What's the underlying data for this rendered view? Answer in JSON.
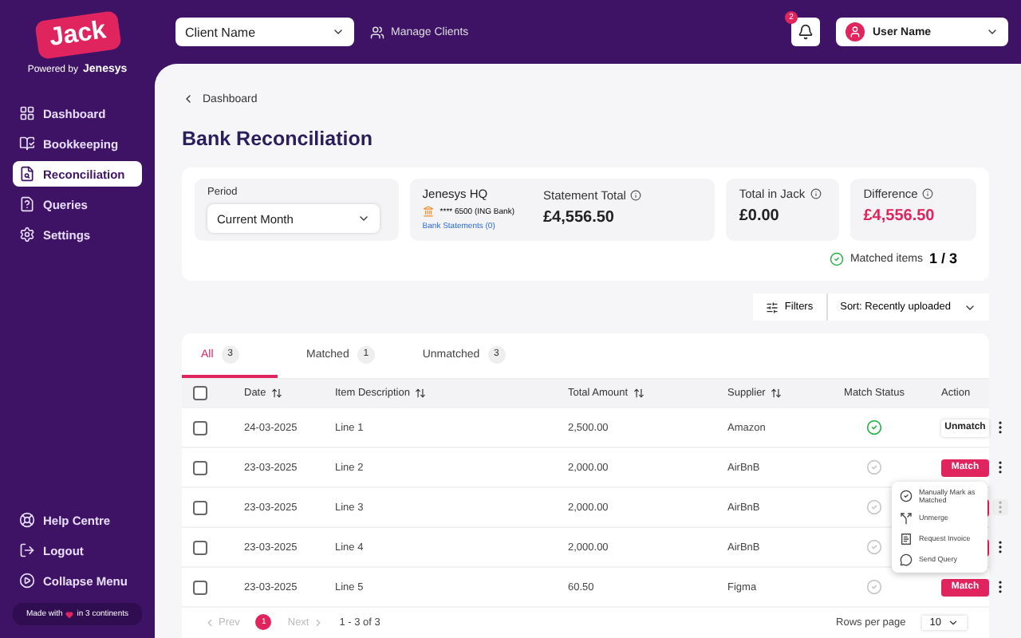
{
  "sidebar": {
    "logo": "Jack",
    "powered_by": "Powered by",
    "brand": "Jenesys",
    "items": [
      {
        "label": "Dashboard",
        "selected": false
      },
      {
        "label": "Bookkeeping",
        "selected": false
      },
      {
        "label": "Reconciliation",
        "selected": true
      },
      {
        "label": "Queries",
        "selected": false
      },
      {
        "label": "Settings",
        "selected": false
      }
    ],
    "bottom_items": [
      "Help Centre",
      "Logout",
      "Collapse Menu"
    ],
    "footer_before": "Made with",
    "footer_after": "in 3 continents"
  },
  "topbar": {
    "client_select": "Client Name",
    "manage_clients": "Manage Clients",
    "notification_count": "2",
    "user_name": "User Name"
  },
  "breadcrumb": "Dashboard",
  "title": "Bank Reconciliation",
  "summary": {
    "period_label": "Period",
    "period_value": "Current Month",
    "account_name": "Jenesys HQ",
    "account_number": "**** 6500 (ING Bank)",
    "statements_link": "Bank Statements (0)",
    "totals": [
      {
        "label": "Statement Total",
        "value": "£4,556.50",
        "kind": "normal"
      },
      {
        "label": "Total in Jack",
        "value": "£0.00",
        "kind": "normal"
      },
      {
        "label": "Difference",
        "value": "£4,556.50",
        "kind": "alert"
      }
    ],
    "matched_label": "Matched items",
    "matched_value": "1 / 3"
  },
  "filters": "Filters",
  "sort": "Sort: Recently uploaded",
  "tabs": [
    {
      "label": "All",
      "count": "3",
      "selected": true
    },
    {
      "label": "Matched",
      "count": "1",
      "selected": false
    },
    {
      "label": "Unmatched",
      "count": "3",
      "selected": false
    }
  ],
  "table": {
    "select_all_checked": false,
    "columns": [
      {
        "label": "Date",
        "sortable": true
      },
      {
        "label": "Item Description",
        "sortable": true
      },
      {
        "label": "Total Amount",
        "sortable": true
      },
      {
        "label": "Supplier",
        "sortable": true
      },
      {
        "label": "Match Status",
        "sortable": false
      },
      {
        "label": "Action",
        "sortable": false
      }
    ],
    "rows": [
      {
        "checked": false,
        "date": "24-03-2025",
        "description": "Line 1",
        "amount": "2,500.00",
        "supplier": "Amazon",
        "matched": true,
        "action": {
          "kind": "unmatch",
          "label": "Unmatch"
        },
        "menu_open": false
      },
      {
        "checked": false,
        "date": "23-03-2025",
        "description": "Line 2",
        "amount": "2,000.00",
        "supplier": "AirBnB",
        "matched": false,
        "action": {
          "kind": "match",
          "label": "Match"
        },
        "menu_open": false
      },
      {
        "checked": false,
        "date": "23-03-2025",
        "description": "Line 3",
        "amount": "2,000.00",
        "supplier": "AirBnB",
        "matched": false,
        "action": {
          "kind": "match"
        },
        "menu_open": true
      },
      {
        "checked": false,
        "date": "23-03-2025",
        "description": "Line 4",
        "amount": "2,000.00",
        "supplier": "AirBnB",
        "matched": false,
        "action": {
          "kind": "match"
        },
        "menu_open": false
      },
      {
        "checked": false,
        "date": "23-03-2025",
        "description": "Line 5",
        "amount": "60.50",
        "supplier": "Figma",
        "matched": false,
        "action": {
          "kind": "match",
          "label": "Match"
        },
        "menu_open": false
      }
    ]
  },
  "row_menu": [
    "Manually Mark as Matched",
    "Unmerge",
    "Request Invoice",
    "Send Query"
  ],
  "pagination": {
    "prev": "Prev",
    "page": "1",
    "next": "Next",
    "range": "1 - 3 of 3",
    "rows_label": "Rows per page",
    "rows_value": "10"
  }
}
